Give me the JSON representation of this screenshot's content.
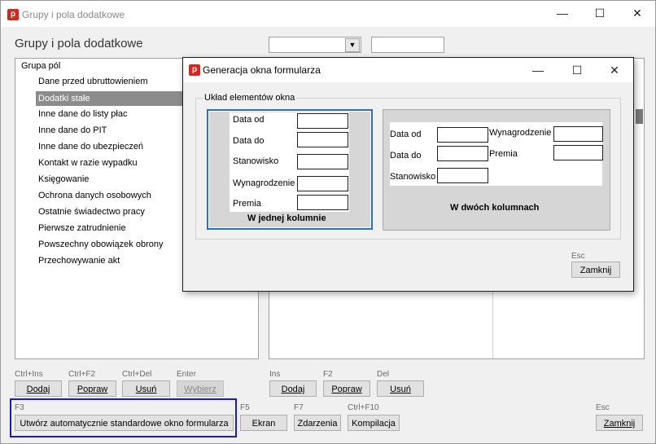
{
  "window": {
    "title": "Grupy i pola dodatkowe",
    "icon_letter": "p",
    "minimize": "—",
    "maximize": "☐",
    "close": "✕"
  },
  "header": {
    "title": "Grupy i pola dodatkowe",
    "combo_value": "",
    "field_value": ""
  },
  "tree": {
    "root": "Grupa pól",
    "items": [
      "Dane przed ubruttowieniem",
      "Dodatki stałe",
      "Inne dane do listy płac",
      "Inne dane do PIT",
      "Inne dane do ubezpieczeń",
      "Kontakt w razie wypadku",
      "Księgowanie",
      "Ochrona danych osobowych",
      "Ostatnie świadectwo pracy",
      "Pierwsze zatrudnienie",
      "Powszechny obowiązek obrony",
      "Przechowywanie akt"
    ],
    "selected_index": 1
  },
  "left_buttons": [
    {
      "shortcut": "Ctrl+Ins",
      "label": "Dodaj",
      "enabled": true
    },
    {
      "shortcut": "Ctrl+F2",
      "label": "Popraw",
      "enabled": true
    },
    {
      "shortcut": "Ctrl+Del",
      "label": "Usuń",
      "enabled": true
    },
    {
      "shortcut": "Enter",
      "label": "Wybierz",
      "enabled": false
    }
  ],
  "right_buttons": [
    {
      "shortcut": "Ins",
      "label": "Dodaj"
    },
    {
      "shortcut": "F2",
      "label": "Popraw"
    },
    {
      "shortcut": "Del",
      "label": "Usuń"
    }
  ],
  "bottom_buttons": {
    "create": {
      "shortcut": "F3",
      "label": "Utwórz automatycznie standardowe okno formularza"
    },
    "screen": {
      "shortcut": "F5",
      "label": "Ekran"
    },
    "events": {
      "shortcut": "F7",
      "label": "Zdarzenia"
    },
    "compile": {
      "shortcut": "Ctrl+F10",
      "label": "Kompilacja"
    },
    "close": {
      "shortcut": "Esc",
      "label": "Zamknij"
    }
  },
  "dialog": {
    "title": "Generacja okna formularza",
    "icon_letter": "p",
    "minimize": "—",
    "maximize": "☐",
    "close": "✕",
    "group_label": "Układ elementów okna",
    "one_column": {
      "caption": "W jednej kolumnie",
      "fields": [
        "Data od",
        "Data do",
        "Stanowisko",
        "Wynagrodzenie",
        "Premia"
      ]
    },
    "two_columns": {
      "caption": "W dwóch kolumnach",
      "left_fields": [
        "Data od",
        "Data do",
        "Stanowisko"
      ],
      "right_fields": [
        "Wynagrodzenie",
        "Premia"
      ]
    },
    "close_shortcut": "Esc",
    "close_label": "Zamknij"
  }
}
